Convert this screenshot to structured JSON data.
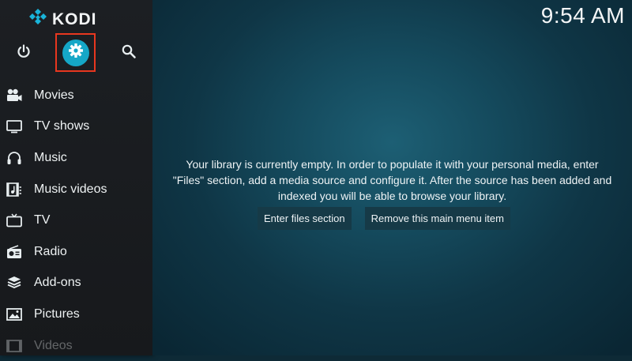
{
  "app": {
    "logo_text": "KODI"
  },
  "clock": {
    "time": "9:54 AM"
  },
  "top_icons": {
    "power_icon": "power-icon",
    "settings_icon": "gear-icon",
    "search_icon": "search-icon",
    "highlight_color": "#e8371f",
    "settings_bg_color": "#15a7c7"
  },
  "sidebar": {
    "items": [
      {
        "label": "Movies",
        "icon": "movie-camera-icon"
      },
      {
        "label": "TV shows",
        "icon": "tv-icon"
      },
      {
        "label": "Music",
        "icon": "headphones-icon"
      },
      {
        "label": "Music videos",
        "icon": "music-video-icon"
      },
      {
        "label": "TV",
        "icon": "live-tv-icon"
      },
      {
        "label": "Radio",
        "icon": "radio-icon"
      },
      {
        "label": "Add-ons",
        "icon": "addons-box-icon"
      },
      {
        "label": "Pictures",
        "icon": "pictures-icon"
      },
      {
        "label": "Videos",
        "icon": "videos-icon"
      }
    ]
  },
  "main": {
    "message_lines": [
      "Your library is currently empty. In order to populate it with your personal media, enter",
      "\"Files\" section, add a media source and configure it. After the source has been added and",
      "indexed you will be able to browse your library."
    ],
    "buttons": {
      "enter_files": "Enter files section",
      "remove_item": "Remove this main menu item"
    }
  }
}
